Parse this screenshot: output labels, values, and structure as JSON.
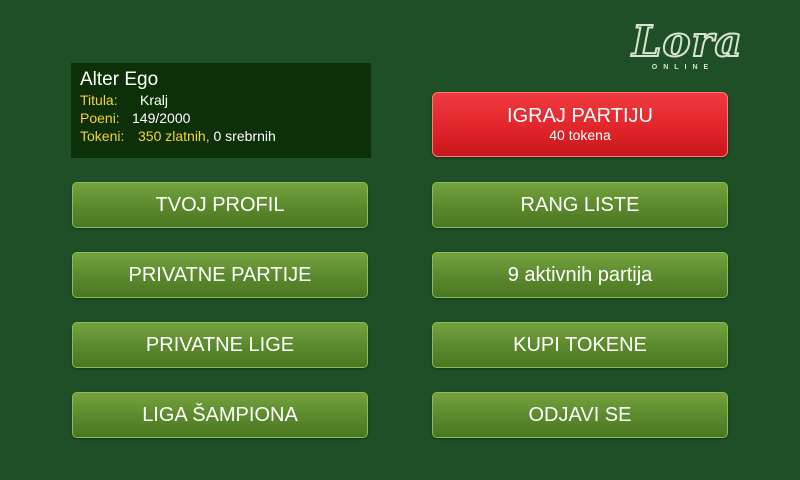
{
  "logo": {
    "word": "Lora",
    "subtitle": "ONLINE"
  },
  "player": {
    "name": "Alter Ego",
    "title_label": "Titula:",
    "title_value": "Kralj",
    "points_label": "Poeni:",
    "points_value": "149/2000",
    "tokens_label": "Tokeni:",
    "tokens_gold": "350 zlatnih,",
    "tokens_silver": "0 srebrnih"
  },
  "play_button": {
    "title": "IGRAJ PARTIJU",
    "subtitle": "40 tokena"
  },
  "buttons": {
    "profile": "TVOJ PROFIL",
    "rankings": "RANG LISTE",
    "private_games": "PRIVATNE PARTIJE",
    "active_games": "9 aktivnih partija",
    "private_leagues": "PRIVATNE LIGE",
    "buy_tokens": "KUPI TOKENE",
    "champions_league": "LIGA ŠAMPIONA",
    "logout": "ODJAVI SE"
  },
  "colors": {
    "background": "#1e4f27",
    "button_green": "#5d8a2e",
    "button_red": "#e1262b",
    "label_yellow": "#f3d336",
    "info_box": "#0d3008"
  }
}
